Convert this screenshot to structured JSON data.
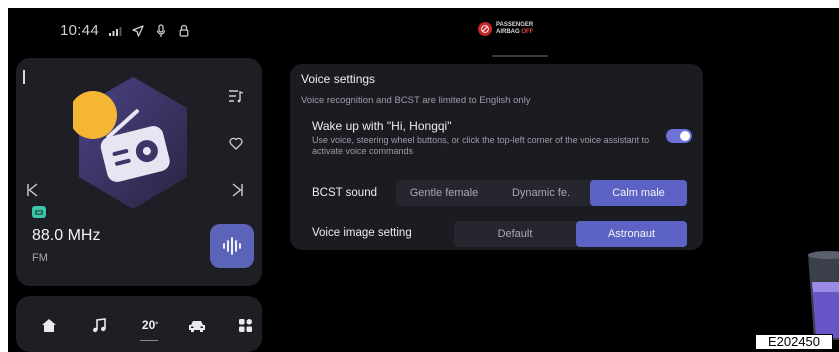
{
  "status_bar": {
    "time": "10:44",
    "airbag_line1": "PASSENGER",
    "airbag_line2": "AIRBAG",
    "airbag_state": "OFF"
  },
  "media": {
    "frequency": "88.0 MHz",
    "band": "FM"
  },
  "dock": {
    "temperature": "20",
    "temperature_unit": "°"
  },
  "voice_settings": {
    "title": "Voice settings",
    "subtitle": "Voice recognition and BCST are limited to English only",
    "wake_label": "Wake up with \"Hi, Hongqi\"",
    "wake_desc": "Use voice, steering wheel buttons, or click the top-left corner of the voice assistant to activate voice commands",
    "wake_enabled": true,
    "bcst_label": "BCST sound",
    "bcst_options": [
      "Gentle female",
      "Dynamic fe.",
      "Calm male"
    ],
    "bcst_selected": "Calm male",
    "image_label": "Voice image setting",
    "image_options": [
      "Default",
      "Astronaut"
    ],
    "image_selected": "Astronaut"
  },
  "figure_code": "E202450",
  "colors": {
    "accent": "#5c63c4",
    "panel": "#1b1b22",
    "card": "#1e1e25",
    "toggle": "#6c72d8",
    "radio_icon": "#3cc6a8"
  }
}
